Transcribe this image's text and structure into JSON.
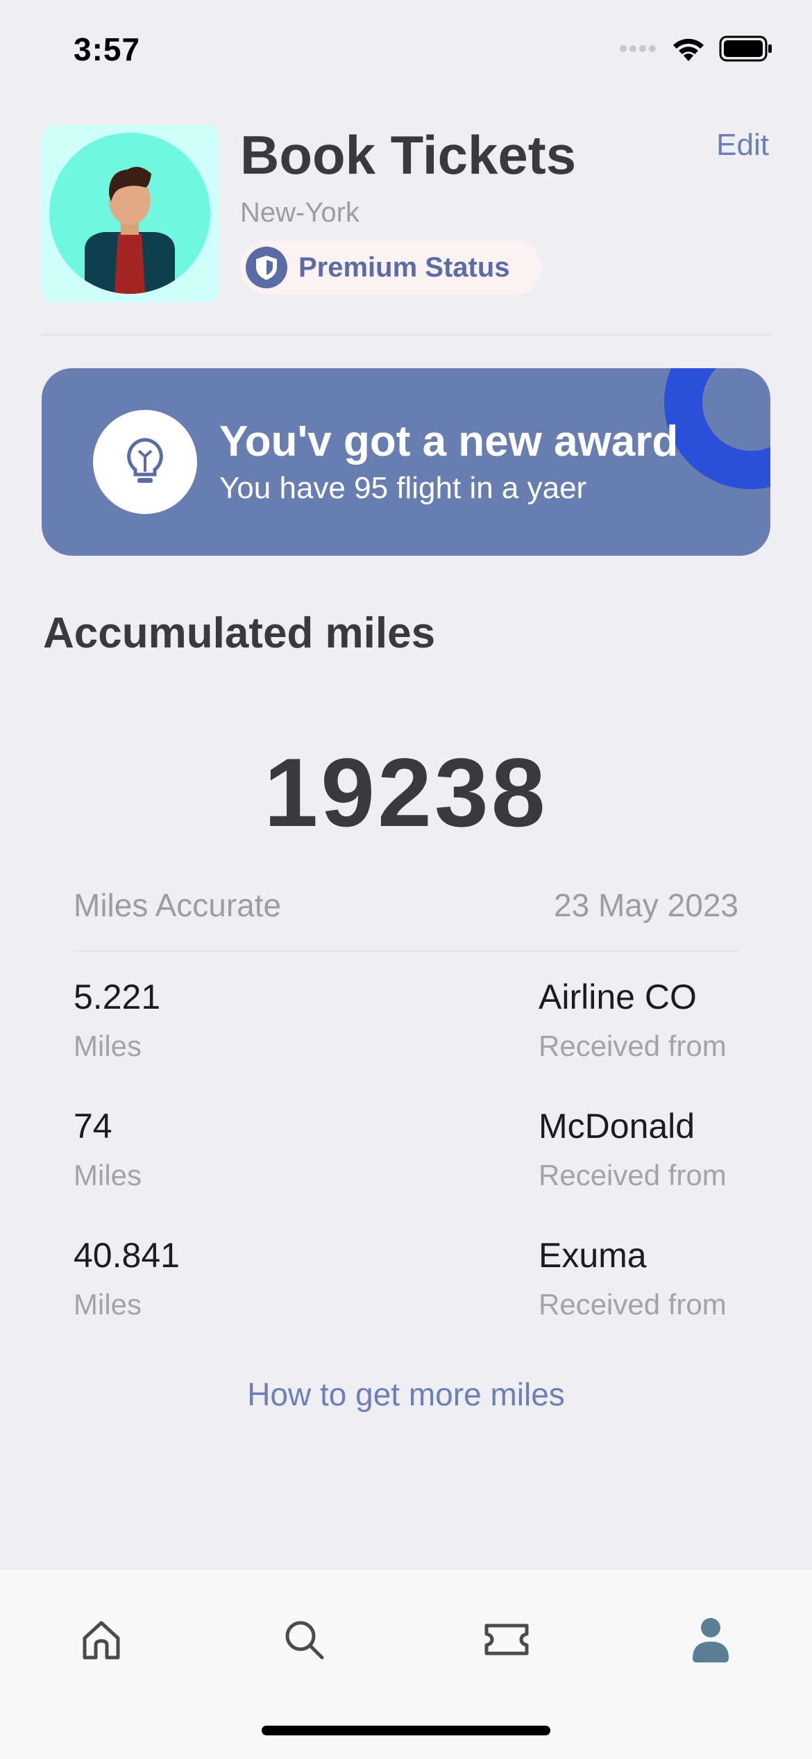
{
  "status_bar": {
    "time": "3:57"
  },
  "profile": {
    "name": "Book Tickets",
    "city": "New-York",
    "status_label": "Premium Status",
    "edit_label": "Edit"
  },
  "award": {
    "title": "You'v got a new award",
    "subtitle": "You have 95 flight in a yaer"
  },
  "miles": {
    "section_title": "Accumulated miles",
    "total": "19238",
    "summary_label": "Miles Accurate",
    "summary_date": "23 May 2023",
    "entries": [
      {
        "amount": "5.221",
        "unit": "Miles",
        "source": "Airline CO",
        "caption": "Received from"
      },
      {
        "amount": "74",
        "unit": "Miles",
        "source": "McDonald",
        "caption": "Received from"
      },
      {
        "amount": "40.841",
        "unit": "Miles",
        "source": "Exuma",
        "caption": "Received from"
      }
    ],
    "more_link": "How to get more miles"
  },
  "tab_bar": {
    "tabs": [
      {
        "icon": "home-icon",
        "active": false
      },
      {
        "icon": "search-icon",
        "active": false
      },
      {
        "icon": "ticket-icon",
        "active": false
      },
      {
        "icon": "profile-icon",
        "active": true
      }
    ]
  },
  "colors": {
    "accent": "#5A6BA5",
    "banner": "#687DB0",
    "banner_ring": "#2B4FD8",
    "background": "#EFEEF3"
  }
}
